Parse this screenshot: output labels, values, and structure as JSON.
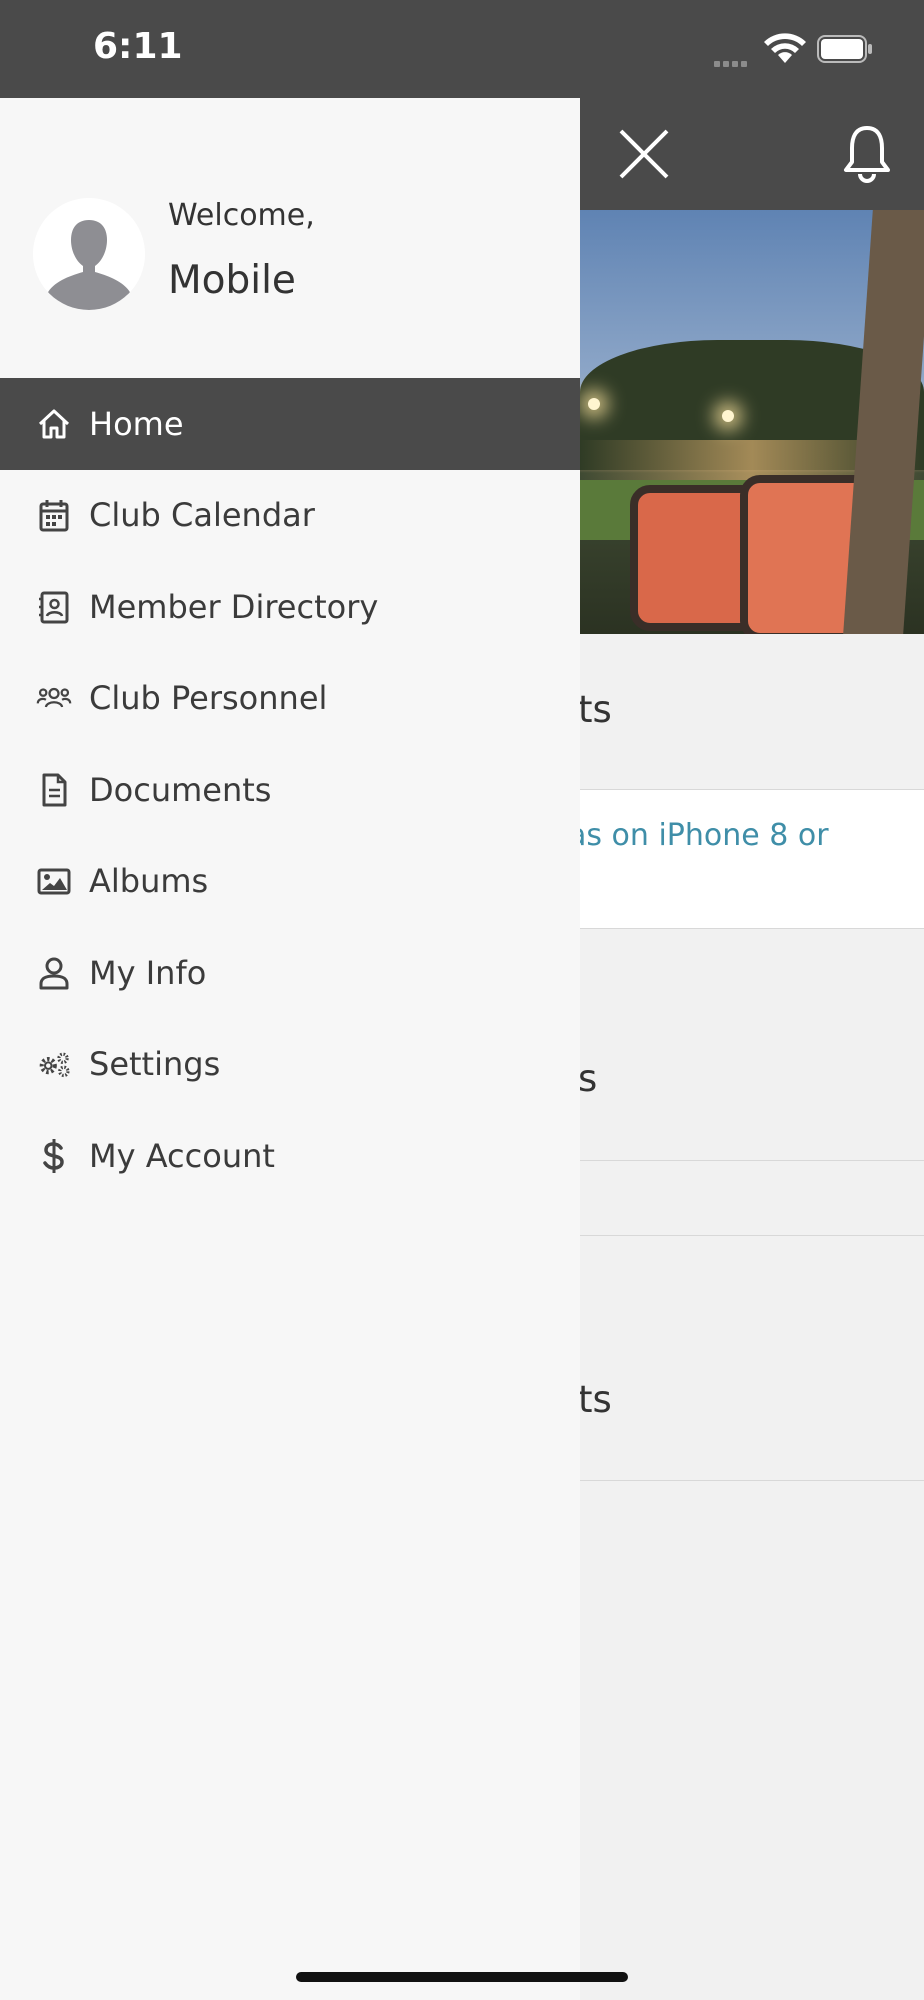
{
  "status_bar": {
    "time": "6:11"
  },
  "background": {
    "rows": [
      {
        "text": "ts"
      },
      {
        "link": "as on iPhone 8 or"
      },
      {
        "text": "s"
      },
      {
        "text": "ts"
      }
    ]
  },
  "drawer": {
    "welcome": "Welcome,",
    "user_name": "Mobile",
    "menu": [
      {
        "label": "Home",
        "icon": "home-icon",
        "active": true
      },
      {
        "label": "Club Calendar",
        "icon": "calendar-icon"
      },
      {
        "label": "Member Directory",
        "icon": "contact-card-icon"
      },
      {
        "label": "Club Personnel",
        "icon": "users-icon"
      },
      {
        "label": "Documents",
        "icon": "document-icon"
      },
      {
        "label": "Albums",
        "icon": "image-icon"
      },
      {
        "label": "My Info",
        "icon": "user-icon"
      },
      {
        "label": "Settings",
        "icon": "gears-icon"
      },
      {
        "label": "My Account",
        "icon": "dollar-icon"
      }
    ]
  },
  "colors": {
    "header": "#4a4a4a",
    "drawer_bg": "#f7f7f7",
    "link": "#3f8ea8",
    "active_item": "#4a4a4a"
  }
}
